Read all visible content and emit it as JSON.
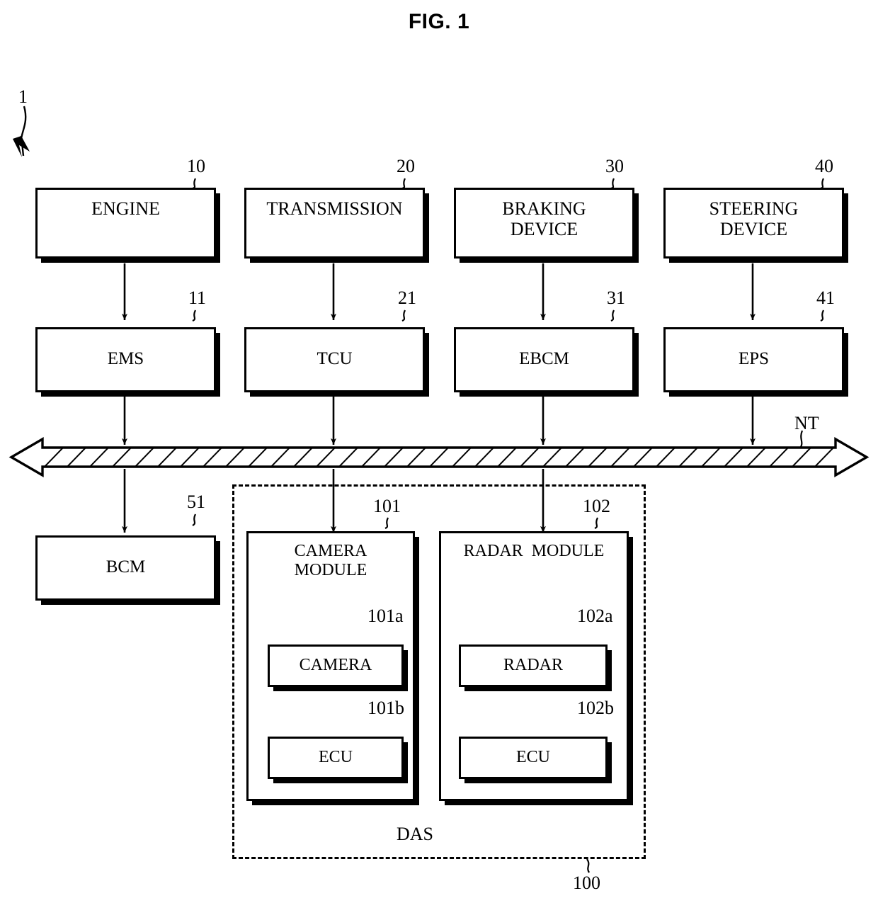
{
  "figure": {
    "title": "FIG. 1",
    "system_ref": "1",
    "network_label": "NT",
    "das_label": "DAS",
    "das_ref": "100"
  },
  "actuators": [
    {
      "label": "ENGINE",
      "ref": "10",
      "lines": [
        "ENGINE"
      ]
    },
    {
      "label": "TRANSMISSION",
      "ref": "20",
      "lines": [
        "TRANSMISSION"
      ]
    },
    {
      "label": "BRAKING DEVICE",
      "ref": "30",
      "lines": [
        "BRAKING",
        "DEVICE"
      ]
    },
    {
      "label": "STEERING DEVICE",
      "ref": "40",
      "lines": [
        "STEERING",
        "DEVICE"
      ]
    }
  ],
  "controllers": [
    {
      "label": "EMS",
      "ref": "11"
    },
    {
      "label": "TCU",
      "ref": "21"
    },
    {
      "label": "EBCM",
      "ref": "31"
    },
    {
      "label": "EPS",
      "ref": "41"
    }
  ],
  "body_module": {
    "label": "BCM",
    "ref": "51"
  },
  "das": {
    "label": "DAS",
    "ref": "100",
    "modules": [
      {
        "ref": "101",
        "lines": [
          "CAMERA",
          "MODULE"
        ],
        "children": [
          {
            "label": "CAMERA",
            "ref": "101a"
          },
          {
            "label": "ECU",
            "ref": "101b"
          }
        ]
      },
      {
        "ref": "102",
        "lines": [
          "RADAR  MODULE"
        ],
        "children": [
          {
            "label": "RADAR",
            "ref": "102a"
          },
          {
            "label": "ECU",
            "ref": "102b"
          }
        ]
      }
    ]
  },
  "colors": {
    "stroke": "#000000",
    "background": "#ffffff"
  }
}
